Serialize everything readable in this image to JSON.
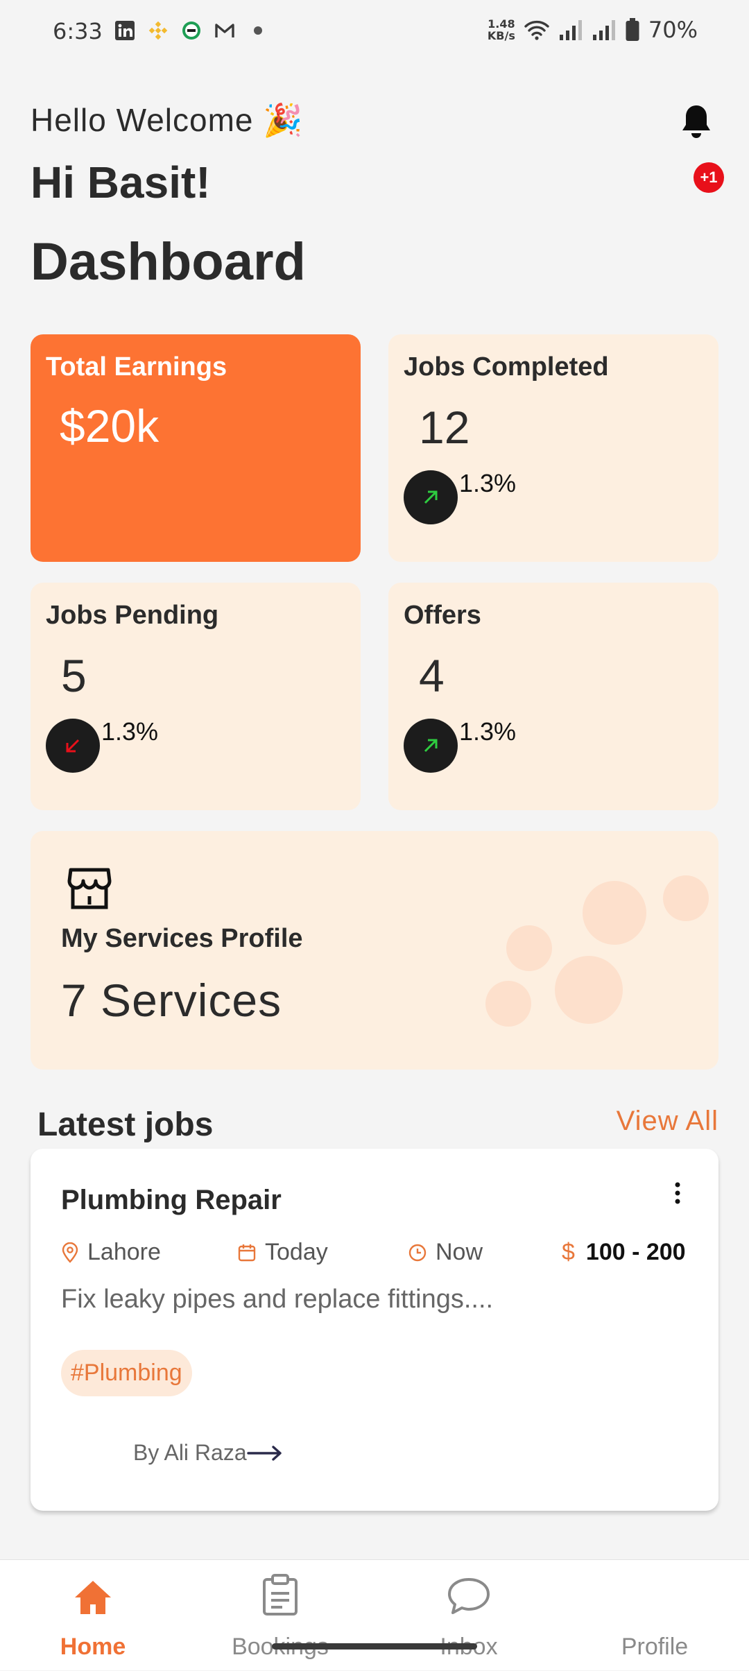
{
  "status_bar": {
    "time": "6:33",
    "net_speed_value": "1.48",
    "net_speed_unit": "KB/s",
    "battery": "70%"
  },
  "header": {
    "greeting": "Hello Welcome 🎉",
    "name": "Hi Basit!",
    "title": "Dashboard",
    "notification_badge": "+1"
  },
  "stats": {
    "earnings": {
      "label": "Total Earnings",
      "value": "$20k"
    },
    "completed": {
      "label": "Jobs Completed",
      "value": "12",
      "change": "1.3%",
      "trend": "up"
    },
    "pending": {
      "label": "Jobs Pending",
      "value": "5",
      "change": "1.3%",
      "trend": "down"
    },
    "offers": {
      "label": "Offers",
      "value": "4",
      "change": "1.3%",
      "trend": "up"
    }
  },
  "services": {
    "label": "My Services Profile",
    "count": "7 Services"
  },
  "latest_jobs": {
    "heading": "Latest jobs",
    "view_all": "View All",
    "job": {
      "title": "Plumbing Repair",
      "location": "Lahore",
      "date": "Today",
      "time": "Now",
      "price": "100 - 200",
      "description": "Fix leaky pipes and replace fittings....",
      "tag": "#Plumbing",
      "author": "By Ali Raza"
    }
  },
  "nav": {
    "home": "Home",
    "bookings": "Bookings",
    "inbox": "Inbox",
    "profile": "Profile"
  },
  "colors": {
    "accent": "#f07135",
    "card_bg": "#fdefe0",
    "trend_up": "#2ecc40",
    "trend_down": "#e8101a"
  }
}
